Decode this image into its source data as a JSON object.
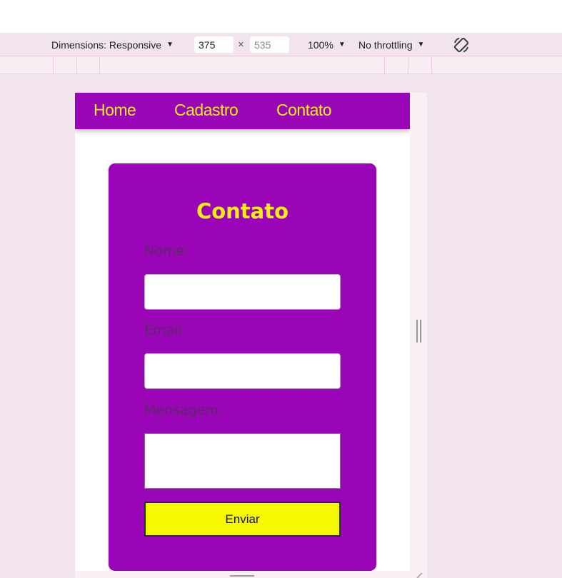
{
  "devtools": {
    "dimensions_label": "Dimensions: Responsive",
    "width_value": "375",
    "height_placeholder": "535",
    "times_sign": "×",
    "zoom_label": "100%",
    "throttle_label": "No throttling",
    "caret": "▼",
    "icons": [
      "rotate-icon",
      "resize-handle",
      "corner-resize-icon"
    ]
  },
  "nav": {
    "items": [
      {
        "label": "Home"
      },
      {
        "label": "Cadastro"
      },
      {
        "label": "Contato"
      }
    ]
  },
  "form": {
    "title": "Contato",
    "name_label": "Nome:",
    "name_value": "",
    "email_label": "Email:",
    "email_value": "",
    "message_label": "Mensagem:",
    "message_value": "",
    "submit_label": "Enviar"
  },
  "colors": {
    "brand_purple": "#9b05b8",
    "accent_yellow": "#f5ee13",
    "button_yellow": "#f7f700",
    "devtools_bg": "#f1e4ec"
  }
}
